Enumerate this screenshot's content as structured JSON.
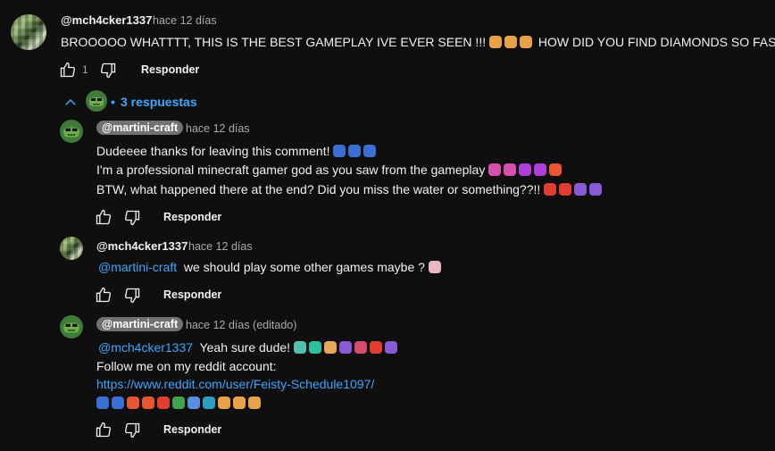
{
  "top_comment": {
    "author": "@mch4cker1337",
    "time": "hace 12 días",
    "text_a": "BROOOOO WHATTTT, THIS IS THE BEST GAMEPLAY IVE EVER SEEN !!!",
    "text_b": "HOW DID YOU FIND DIAMONDS SO FAST ???",
    "likes": "1",
    "reply_label": "Responder"
  },
  "replies_toggle": {
    "label": "3 respuestas",
    "dot": "•"
  },
  "reply1": {
    "author": "@martini-craft",
    "time": "hace 12 días",
    "line1": "Dudeeee thanks for leaving this comment!",
    "line2": "I'm a professional minecraft gamer god as you saw from the gameplay",
    "line3": "BTW, what happened there at the end? Did you miss the water or something??!!",
    "reply_label": "Responder"
  },
  "reply2": {
    "author": "@mch4cker1337",
    "time": "hace 12 días",
    "mention": "@martini-craft",
    "text": "we should play some other games maybe ?",
    "reply_label": "Responder"
  },
  "reply3": {
    "author": "@martini-craft",
    "time": "hace 12 días (editado)",
    "mention": "@mch4cker1337",
    "text": "Yeah sure dude!",
    "line2": "Follow me on my reddit account:",
    "link": "https://www.reddit.com/user/Feisty-Schedule1097/",
    "reply_label": "Responder"
  },
  "colors": {
    "link": "#3ea6ff",
    "background": "#0f0f0f",
    "chip": "#717171"
  }
}
